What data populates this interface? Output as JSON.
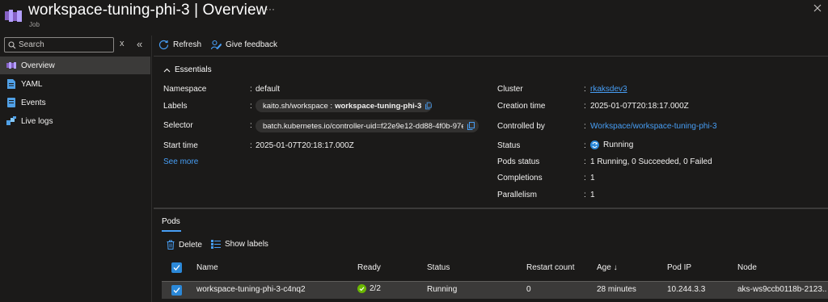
{
  "header": {
    "title": "workspace-tuning-phi-3 | Overview",
    "subtitle": "Job",
    "more": "···"
  },
  "sidebar": {
    "search_placeholder": "Search",
    "clear_label": "x",
    "collapse_label": "«",
    "items": [
      {
        "label": "Overview",
        "icon": "overview-icon",
        "active": true
      },
      {
        "label": "YAML",
        "icon": "yaml-file-icon"
      },
      {
        "label": "Events",
        "icon": "events-icon"
      },
      {
        "label": "Live logs",
        "icon": "live-logs-icon"
      }
    ]
  },
  "toolbar": {
    "refresh_label": "Refresh",
    "feedback_label": "Give feedback"
  },
  "essentials": {
    "toggle_label": "Essentials",
    "left": {
      "namespace_label": "Namespace",
      "namespace_value": "default",
      "labels_label": "Labels",
      "labels_key": "kaito.sh/workspace :",
      "labels_value": "workspace-tuning-phi-3",
      "selector_label": "Selector",
      "selector_value": "batch.kubernetes.io/controller-uid=f22e9e12-dd88-4f0b-97e",
      "start_time_label": "Start time",
      "start_time_value": "2025-01-07T20:18:17.000Z",
      "see_more": "See more"
    },
    "right": {
      "cluster_label": "Cluster",
      "cluster_value": "rkaksdev3",
      "creation_label": "Creation time",
      "creation_value": "2025-01-07T20:18:17.000Z",
      "controlled_label": "Controlled by",
      "controlled_value": "Workspace/workspace-tuning-phi-3",
      "status_label": "Status",
      "status_value": "Running",
      "pods_status_label": "Pods status",
      "pods_status_value": "1 Running, 0 Succeeded, 0 Failed",
      "completions_label": "Completions",
      "completions_value": "1",
      "parallelism_label": "Parallelism",
      "parallelism_value": "1"
    },
    "colon": ":"
  },
  "pods": {
    "tab_label": "Pods",
    "delete_label": "Delete",
    "show_labels_label": "Show labels",
    "columns": [
      "Name",
      "Ready",
      "Status",
      "Restart count",
      "Age ↓",
      "Pod IP",
      "Node"
    ],
    "rows": [
      {
        "name": "workspace-tuning-phi-3-c4nq2",
        "ready": "2/2",
        "status": "Running",
        "restart_count": "0",
        "age": "28 minutes",
        "pod_ip": "10.244.3.3",
        "node": "aks-ws9ccb0118b-2123..."
      }
    ]
  },
  "colors": {
    "accent": "#479ef5",
    "checkbox": "#2b88d8",
    "success": "#6bb700",
    "background": "#1b1a19"
  }
}
